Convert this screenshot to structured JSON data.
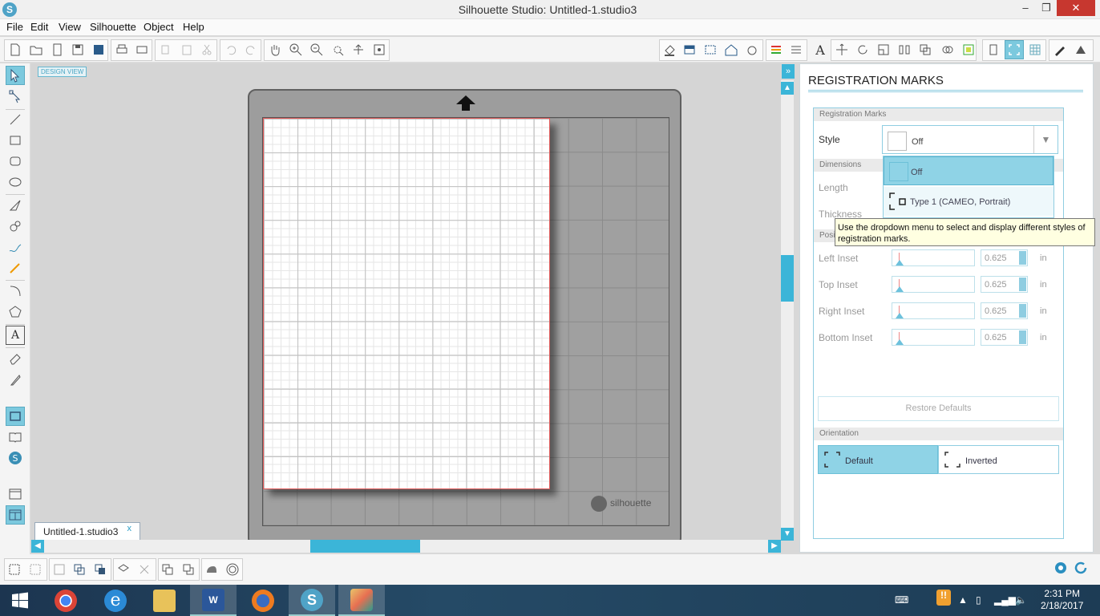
{
  "window": {
    "title": "Silhouette Studio: Untitled-1.studio3",
    "min": "–",
    "max": "❐",
    "close": "✕"
  },
  "menu": [
    "File",
    "Edit",
    "View",
    "Silhouette",
    "Object",
    "Help"
  ],
  "canvas": {
    "design_view_label": "DESIGN VIEW",
    "mat_brand": "silhouette"
  },
  "doc_tab": {
    "name": "Untitled-1.studio3",
    "close": "x"
  },
  "panel": {
    "title": "REGISTRATION MARKS",
    "section_reg": "Registration Marks",
    "style_label": "Style",
    "style_value": "Off",
    "dropdown_options": [
      "Off",
      "Type 1 (CAMEO, Portrait)"
    ],
    "section_dimensions": "Dimensions",
    "length_label": "Length",
    "thickness_label": "Thickness",
    "section_position": "Position",
    "left_inset_label": "Left Inset",
    "top_inset_label": "Top Inset",
    "right_inset_label": "Right Inset",
    "bottom_inset_label": "Bottom Inset",
    "left_inset": "0.625",
    "top_inset": "0.625",
    "right_inset": "0.625",
    "bottom_inset": "0.625",
    "unit": "in",
    "restore_defaults": "Restore Defaults",
    "section_orientation": "Orientation",
    "orientation_default": "Default",
    "orientation_inverted": "Inverted",
    "tooltip": "Use the dropdown menu to select and display different styles of registration marks."
  },
  "taskbar": {
    "time": "2:31 PM",
    "date": "2/18/2017"
  },
  "colors": {
    "accent": "#3bb5d8",
    "selected": "#8fd3e6",
    "close": "#c7372f"
  }
}
